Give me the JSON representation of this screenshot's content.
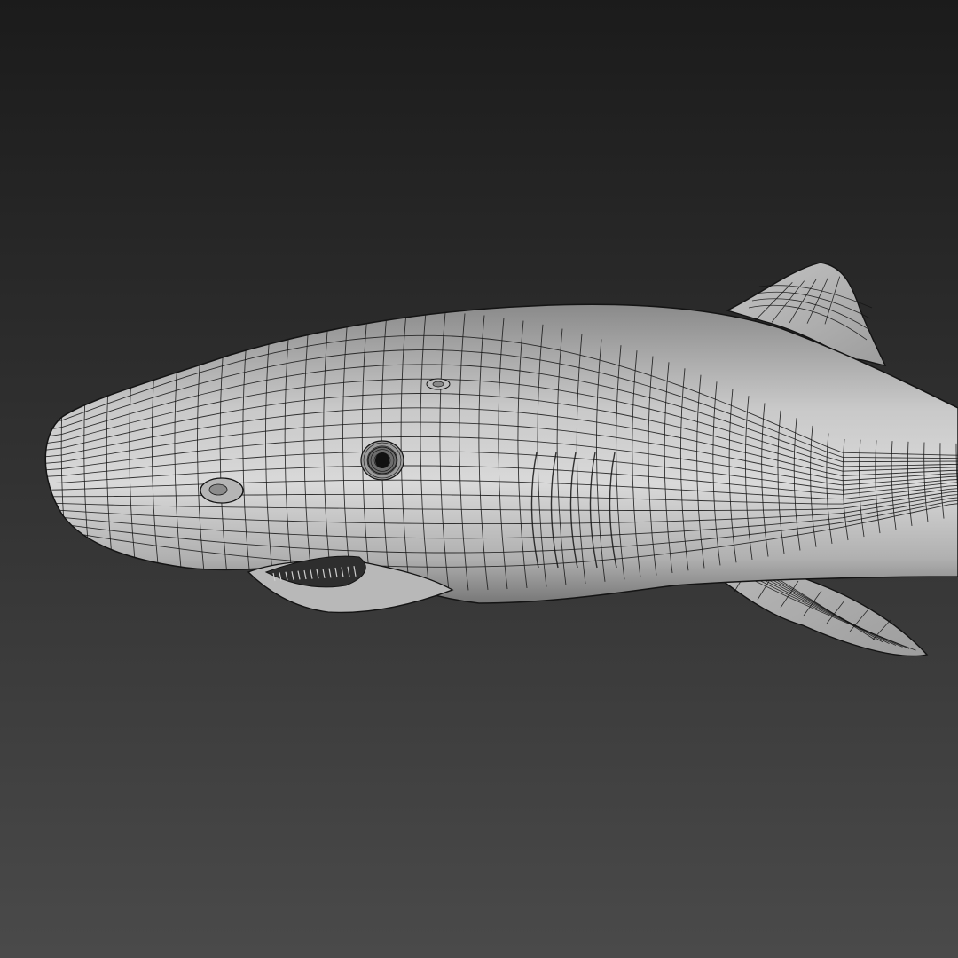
{
  "viewport": {
    "background_top_color": "#1b1b1b",
    "background_bottom_color": "#4a4a4a",
    "mesh_fill_color": "#9a9a9a",
    "mesh_highlight_color": "#d8d8d8",
    "wire_color": "#141414",
    "display_mode": "shaded-with-wireframe",
    "model": "shark"
  }
}
